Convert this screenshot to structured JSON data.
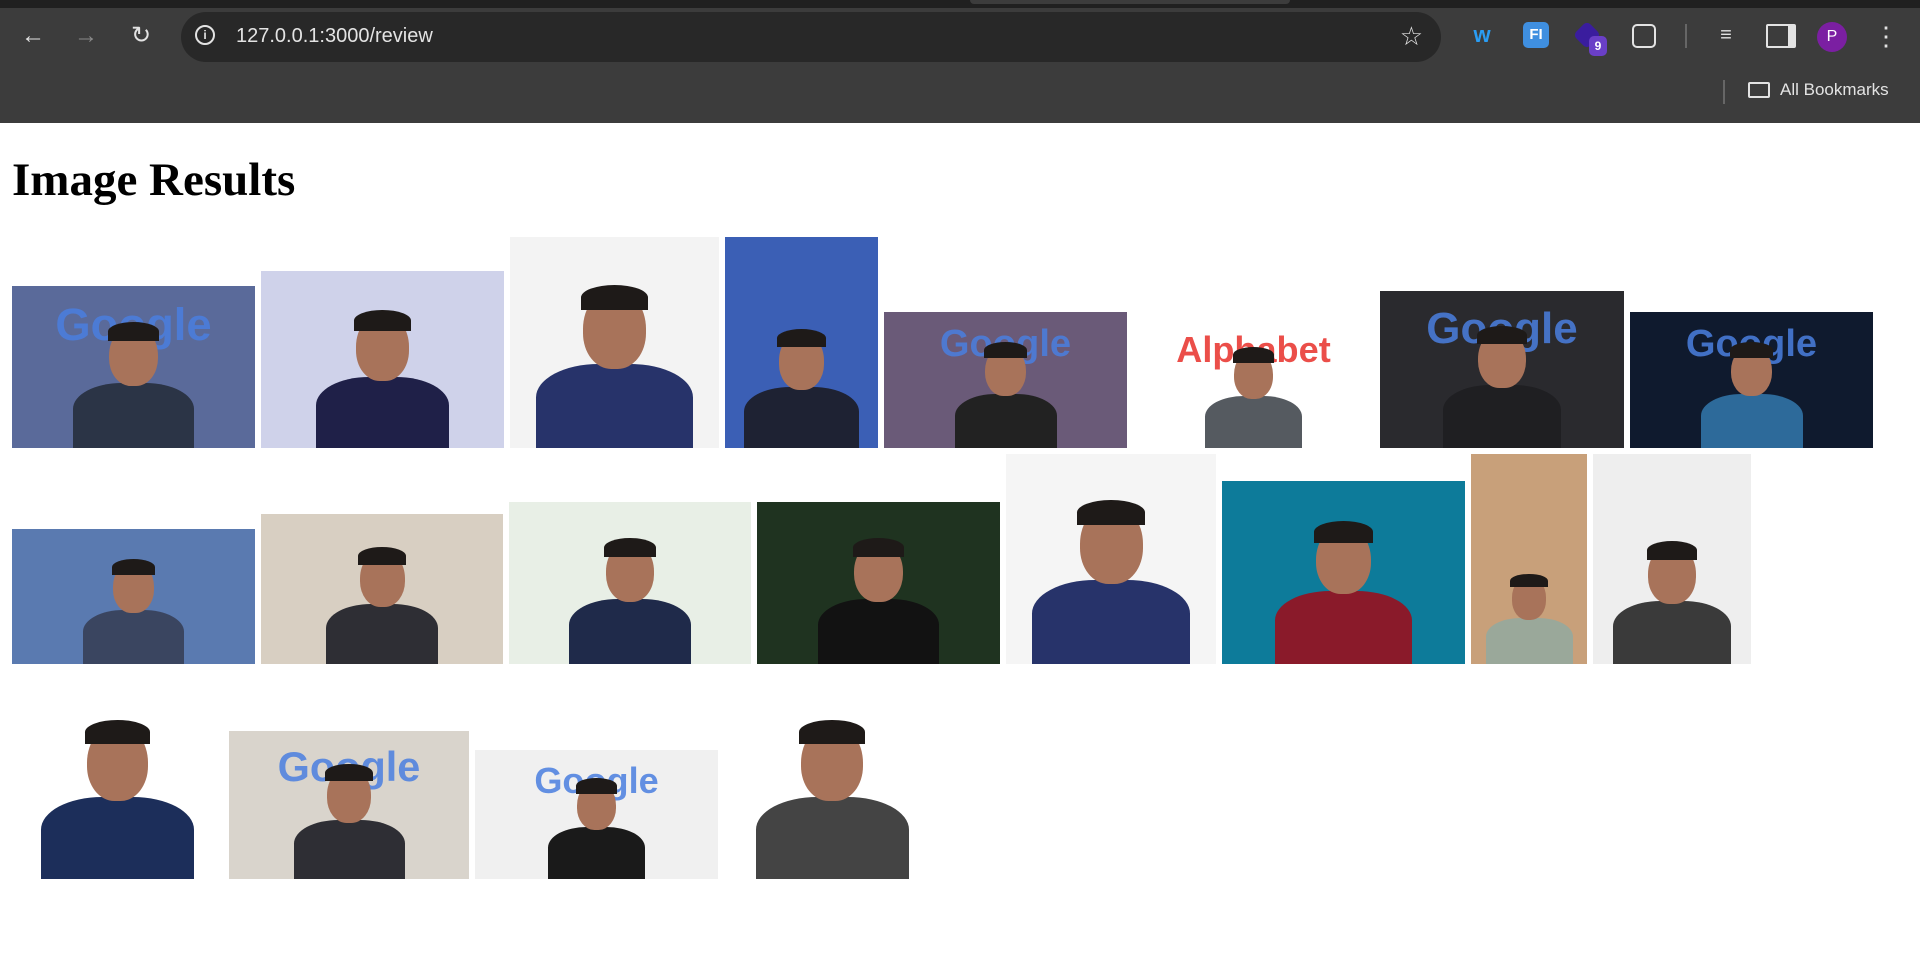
{
  "browser": {
    "url": "127.0.0.1:3000/review",
    "extension_badge": "9",
    "avatar_letter": "P",
    "bookmarks_label": "All Bookmarks"
  },
  "page": {
    "title": "Image Results"
  },
  "images": {
    "logos": {
      "google": "Google",
      "alphabet": "Alphabet"
    }
  }
}
